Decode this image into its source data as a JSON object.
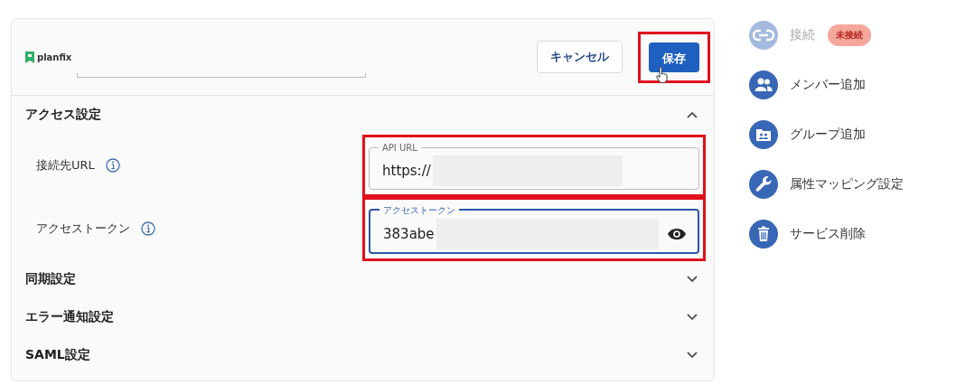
{
  "header": {
    "logo_text": "planfix",
    "buttons": [
      {
        "label": "キャンセル",
        "kind": "secondary",
        "highlighted": false
      },
      {
        "label": "保存",
        "kind": "primary",
        "highlighted": true
      }
    ]
  },
  "sections": [
    {
      "title": "アクセス設定",
      "expanded": true,
      "fields": [
        {
          "label": "接続先URL",
          "field_label": "API URL",
          "value": "https://",
          "focused": false,
          "highlighted": true,
          "password": false
        },
        {
          "label": "アクセストークン",
          "field_label": "アクセストークン",
          "value": "383abe",
          "focused": true,
          "highlighted": true,
          "password": true
        }
      ]
    },
    {
      "title": "同期設定",
      "expanded": false
    },
    {
      "title": "エラー通知設定",
      "expanded": false
    },
    {
      "title": "SAML設定",
      "expanded": false
    }
  ],
  "actions": [
    {
      "label": "接続",
      "disabled": true,
      "badge": "未接続"
    },
    {
      "label": "メンバー追加",
      "disabled": false
    },
    {
      "label": "グループ追加",
      "disabled": false
    },
    {
      "label": "属性マッピング設定",
      "disabled": false
    },
    {
      "label": "サービス削除",
      "disabled": false
    }
  ]
}
